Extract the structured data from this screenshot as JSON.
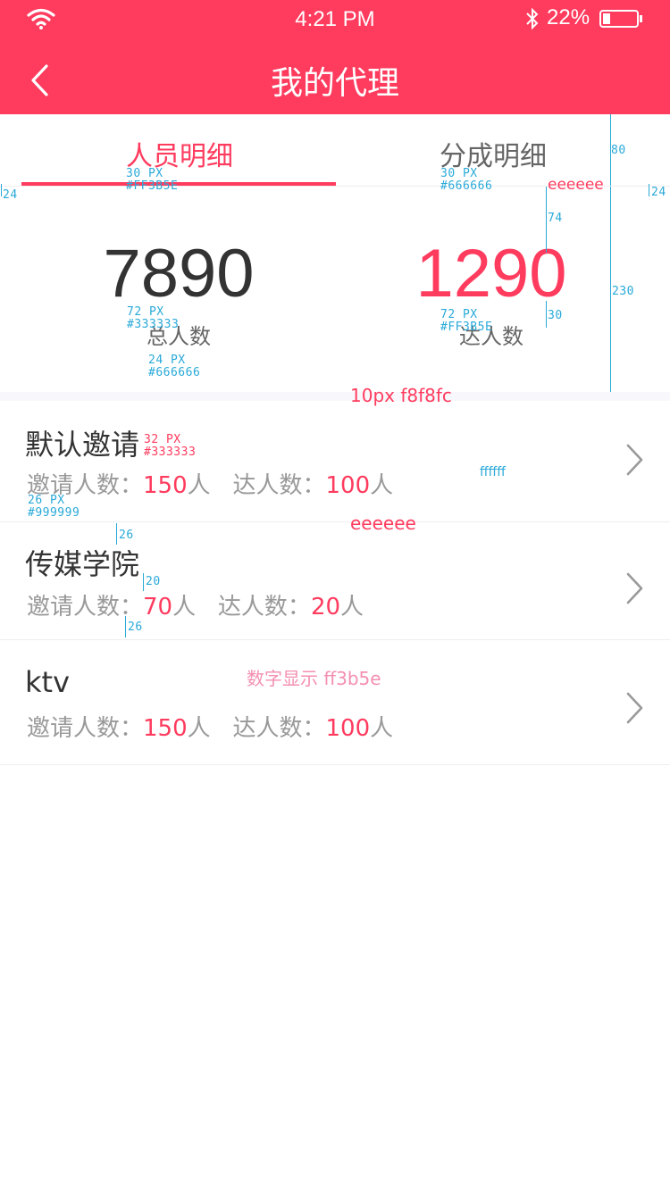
{
  "status_bar": {
    "time": "4:21 PM",
    "battery": "22%"
  },
  "header": {
    "title": "我的代理"
  },
  "tabs": [
    {
      "label": "人员明细",
      "active": true
    },
    {
      "label": "分成明细",
      "active": false
    }
  ],
  "stats": [
    {
      "value": "7890",
      "label": "总人数"
    },
    {
      "value": "1290",
      "label": "达人数"
    }
  ],
  "list": [
    {
      "title": "默认邀请",
      "invite_label": "邀请人数：",
      "invite_count": "150",
      "invite_unit": "人",
      "expert_label": "达人数：",
      "expert_count": "100",
      "expert_unit": "人"
    },
    {
      "title": "传媒学院",
      "invite_label": "邀请人数：",
      "invite_count": "70",
      "invite_unit": "人",
      "expert_label": "达人数：",
      "expert_count": "20",
      "expert_unit": "人"
    },
    {
      "title": "ktv",
      "invite_label": "邀请人数：",
      "invite_count": "150",
      "invite_unit": "人",
      "expert_label": "达人数：",
      "expert_count": "100",
      "expert_unit": "人"
    }
  ],
  "annotations": {
    "m24": "24",
    "tab_px": "30 PX",
    "tab_active_color": "#FF3B5E",
    "tab_inactive_color": "#666666",
    "divider_color": "eeeeee",
    "m80": "80",
    "m74": "74",
    "m230": "230",
    "m30": "30",
    "num_px": "72 PX",
    "num_color_1": "#333333",
    "num_color_2": "#FF3B5E",
    "label_px": "24 PX",
    "label_color": "#666666",
    "band_note": "10px   f8f8fc",
    "title_px": "32 PX",
    "title_color": "#333333",
    "sub_px": "26 PX",
    "sub_color": "#999999",
    "row_bg": "ffffff",
    "row_divider": "eeeeee",
    "m26": "26",
    "m20": "20",
    "number_note": "数字显示 ff3b5e"
  },
  "colors": {
    "accent": "#ff3b5e",
    "divider": "#eeeeee",
    "band": "#f8f8fc"
  }
}
